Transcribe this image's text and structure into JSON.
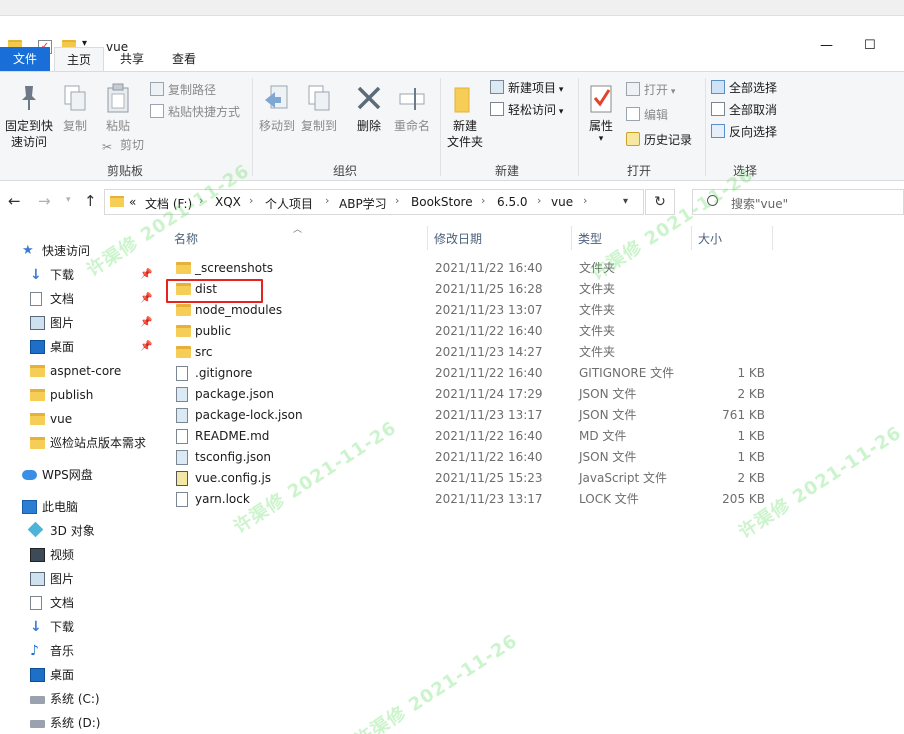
{
  "window": {
    "title": "vue",
    "minimize": "—",
    "maximize": "☐"
  },
  "ribbon": {
    "tabs": [
      "文件",
      "主页",
      "共享",
      "查看"
    ],
    "clipboard": {
      "pin_label": "固定到快\n速访问",
      "copy_label": "复制",
      "paste_label": "粘贴",
      "copy_path": "复制路径",
      "paste_shortcut": "粘贴快捷方式",
      "cut": "剪切",
      "group": "剪贴板"
    },
    "organize": {
      "move_to": "移动到",
      "copy_to": "复制到",
      "delete": "删除",
      "rename": "重命名",
      "group": "组织"
    },
    "new": {
      "new_folder": "新建\n文件夹",
      "new_item": "新建项目",
      "easy_access": "轻松访问",
      "group": "新建"
    },
    "open": {
      "properties": "属性",
      "open": "打开",
      "edit": "编辑",
      "history": "历史记录",
      "group": "打开"
    },
    "select": {
      "select_all": "全部选择",
      "select_none": "全部取消",
      "invert": "反向选择",
      "group": "选择"
    }
  },
  "address": {
    "overflow": "«",
    "crumbs": [
      "文档 (F:)",
      "XQX",
      "个人项目",
      "ABP学习",
      "BookStore",
      "6.5.0",
      "vue"
    ],
    "search_placeholder": "搜索\"vue\""
  },
  "sidebar": {
    "items": [
      {
        "label": "快速访问",
        "icon": "star-icon",
        "pinned": false
      },
      {
        "label": "下载",
        "icon": "download-icon",
        "pinned": true
      },
      {
        "label": "文档",
        "icon": "document-icon",
        "pinned": true
      },
      {
        "label": "图片",
        "icon": "picture-icon",
        "pinned": true
      },
      {
        "label": "桌面",
        "icon": "desktop-icon",
        "pinned": true
      },
      {
        "label": "aspnet-core",
        "icon": "folder-icon",
        "pinned": false
      },
      {
        "label": "publish",
        "icon": "folder-icon",
        "pinned": false
      },
      {
        "label": "vue",
        "icon": "folder-icon",
        "pinned": false
      },
      {
        "label": "巡检站点版本需求",
        "icon": "folder-icon",
        "pinned": false
      },
      {
        "label": "WPS网盘",
        "icon": "cloud-icon",
        "pinned": false
      },
      {
        "label": "此电脑",
        "icon": "computer-icon",
        "pinned": false
      },
      {
        "label": "3D 对象",
        "icon": "cube-icon",
        "pinned": false
      },
      {
        "label": "视频",
        "icon": "video-icon",
        "pinned": false
      },
      {
        "label": "图片",
        "icon": "picture-icon",
        "pinned": false
      },
      {
        "label": "文档",
        "icon": "document-icon",
        "pinned": false
      },
      {
        "label": "下载",
        "icon": "download-icon",
        "pinned": false
      },
      {
        "label": "音乐",
        "icon": "music-icon",
        "pinned": false
      },
      {
        "label": "桌面",
        "icon": "desktop-icon",
        "pinned": false
      },
      {
        "label": "系统 (C:)",
        "icon": "drive-icon",
        "pinned": false
      },
      {
        "label": "系统 (D:)",
        "icon": "drive-icon",
        "pinned": false
      }
    ]
  },
  "columns": {
    "name": "名称",
    "date": "修改日期",
    "type": "类型",
    "size": "大小"
  },
  "files": [
    {
      "name": "_screenshots",
      "date": "2021/11/22 16:40",
      "type": "文件夹",
      "size": "",
      "kind": "folder"
    },
    {
      "name": "dist",
      "date": "2021/11/25 16:28",
      "type": "文件夹",
      "size": "",
      "kind": "folder"
    },
    {
      "name": "node_modules",
      "date": "2021/11/23 13:07",
      "type": "文件夹",
      "size": "",
      "kind": "folder"
    },
    {
      "name": "public",
      "date": "2021/11/22 16:40",
      "type": "文件夹",
      "size": "",
      "kind": "folder"
    },
    {
      "name": "src",
      "date": "2021/11/23 14:27",
      "type": "文件夹",
      "size": "",
      "kind": "folder"
    },
    {
      "name": ".gitignore",
      "date": "2021/11/22 16:40",
      "type": "GITIGNORE 文件",
      "size": "1 KB",
      "kind": "doc"
    },
    {
      "name": "package.json",
      "date": "2021/11/24 17:29",
      "type": "JSON 文件",
      "size": "2 KB",
      "kind": "json"
    },
    {
      "name": "package-lock.json",
      "date": "2021/11/23 13:17",
      "type": "JSON 文件",
      "size": "761 KB",
      "kind": "json"
    },
    {
      "name": "README.md",
      "date": "2021/11/22 16:40",
      "type": "MD 文件",
      "size": "1 KB",
      "kind": "doc"
    },
    {
      "name": "tsconfig.json",
      "date": "2021/11/22 16:40",
      "type": "JSON 文件",
      "size": "1 KB",
      "kind": "json"
    },
    {
      "name": "vue.config.js",
      "date": "2021/11/25 15:23",
      "type": "JavaScript 文件",
      "size": "2 KB",
      "kind": "js"
    },
    {
      "name": "yarn.lock",
      "date": "2021/11/23 13:17",
      "type": "LOCK 文件",
      "size": "205 KB",
      "kind": "doc"
    }
  ],
  "watermark": "许渠修 2021-11-26",
  "colors": {
    "file_tab": "#1a6ed8",
    "highlight": "#e8231f",
    "folder": "#f6cd57"
  }
}
